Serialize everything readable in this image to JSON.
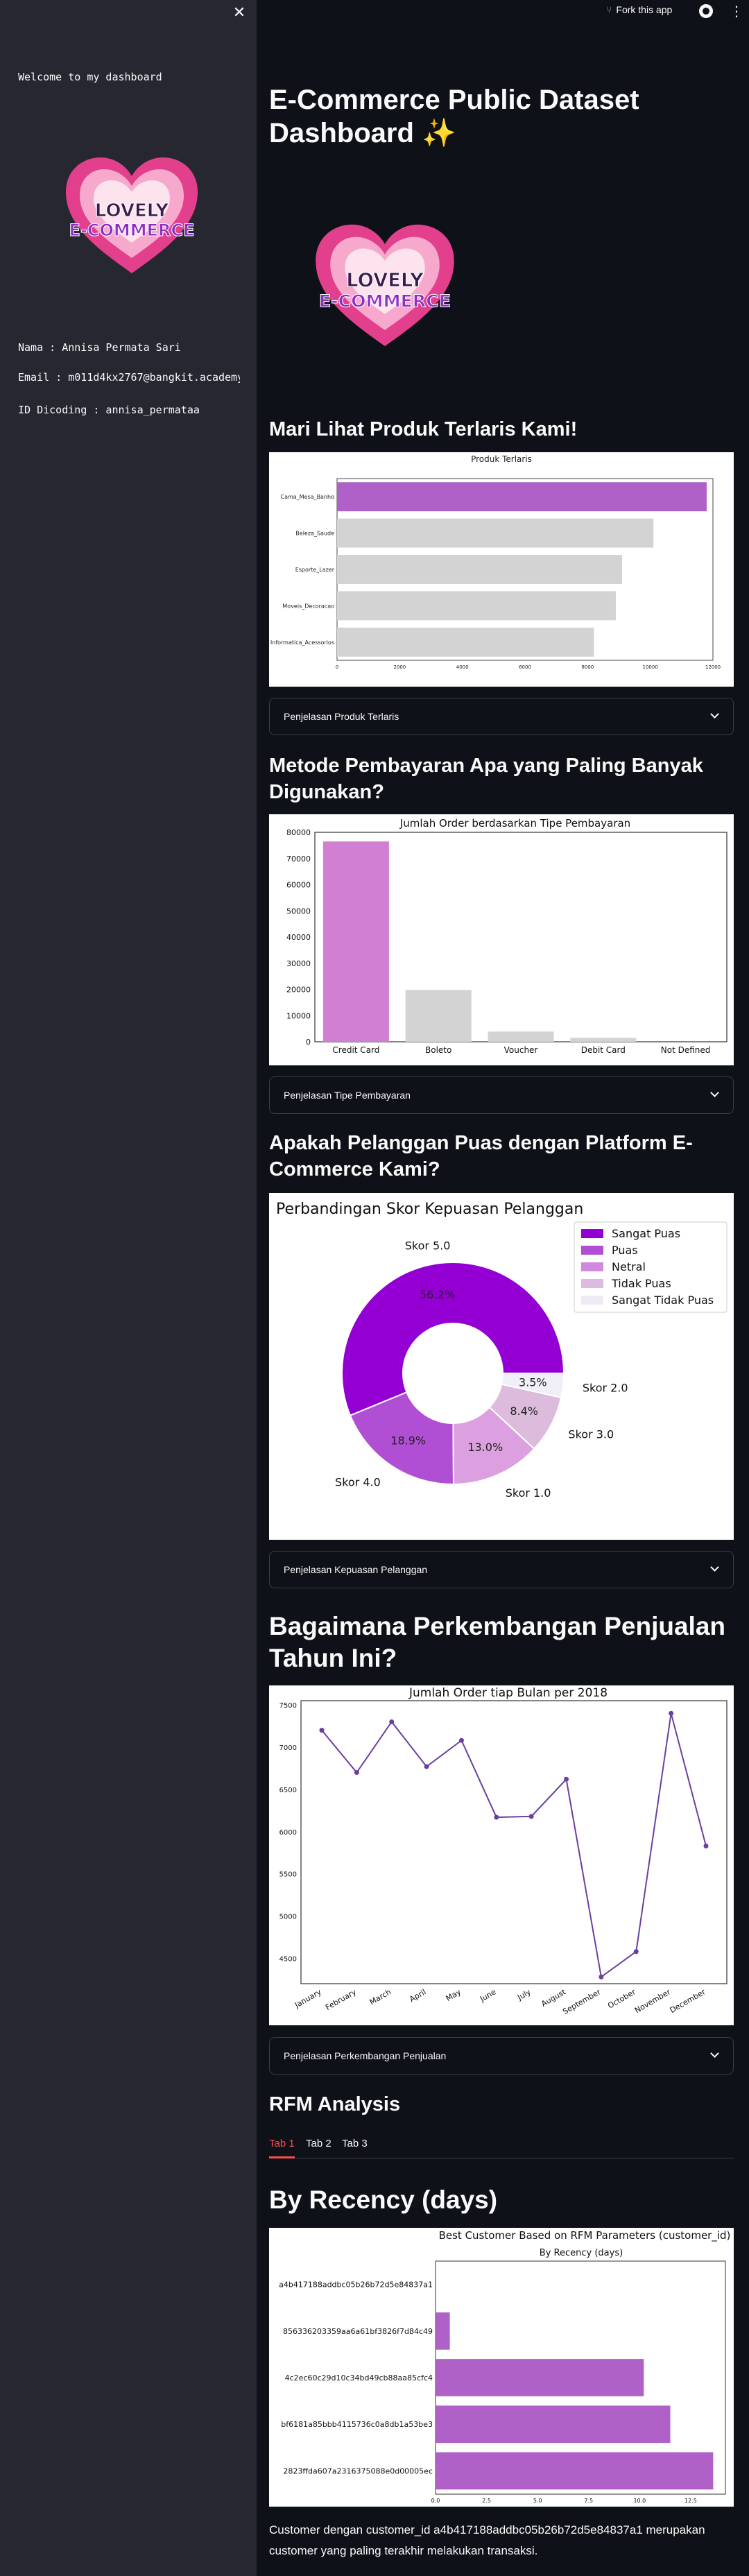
{
  "sidebar": {
    "welcome": "Welcome to my dashboard",
    "nama": "Nama : Annisa Permata Sari",
    "email": "Email : m011d4kx2767@bangkit.academy",
    "id": "ID Dicoding : annisa_permataa",
    "logo_line1": "LOVELY",
    "logo_line2": "E-COMMERCE"
  },
  "header": {
    "fork_label": "Fork this app"
  },
  "page": {
    "title": "E-Commerce Public Dataset Dashboard ✨",
    "logo_line1": "LOVELY",
    "logo_line2": "E-COMMERCE"
  },
  "sections": {
    "produk_heading": "Mari Lihat Produk Terlaris Kami!",
    "produk_expander": "Penjelasan Produk Terlaris",
    "pembayaran_heading": "Metode Pembayaran Apa yang Paling Banyak Digunakan?",
    "pembayaran_expander": "Penjelasan Tipe Pembayaran",
    "kepuasan_heading": "Apakah Pelanggan Puas dengan Platform E-Commerce Kami?",
    "kepuasan_expander": "Penjelasan Kepuasan Pelanggan",
    "penjualan_heading": "Bagaimana Perkembangan Penjualan Tahun Ini?",
    "penjualan_expander": "Penjelasan Perkembangan Penjualan",
    "rfm_heading": "RFM Analysis",
    "recency_heading": "By Recency (days)",
    "recency_text": "Customer dengan customer_id a4b417188addbc05b26b72d5e84837a1 merupakan customer yang paling terakhir melakukan transaksi."
  },
  "tabs": [
    "Tab 1",
    "Tab 2",
    "Tab 3"
  ],
  "colors": {
    "purple_main": "#b061c8",
    "grey_bar": "#d3d3d3",
    "accent_red": "#ff4b4b"
  },
  "chart_data": [
    {
      "type": "bar",
      "orientation": "horizontal",
      "title": "Produk Terlaris",
      "categories": [
        "Cama_Mesa_Banho",
        "Beleza_Saude",
        "Esporte_Lazer",
        "Moveis_Decoracao",
        "Informatica_Acessorios"
      ],
      "values": [
        11800,
        10100,
        9100,
        8900,
        8200
      ],
      "xticks": [
        "0",
        "2000",
        "4000",
        "6000",
        "8000",
        "10000",
        "12000"
      ],
      "xlim": [
        0,
        12000
      ]
    },
    {
      "type": "bar",
      "title": "Jumlah Order berdasarkan Tipe Pembayaran",
      "categories": [
        "Credit Card",
        "Boleto",
        "Voucher",
        "Debit Card",
        "Not Defined"
      ],
      "values": [
        76500,
        19800,
        3900,
        1500,
        3
      ],
      "yticks": [
        "0",
        "10000",
        "20000",
        "30000",
        "40000",
        "50000",
        "60000",
        "70000",
        "80000"
      ],
      "ylim": [
        0,
        80000
      ]
    },
    {
      "type": "pie",
      "title": "Perbandingan Skor Kepuasan Pelanggan",
      "labels": [
        "Skor 5.0",
        "Skor 4.0",
        "Skor 1.0",
        "Skor 3.0",
        "Skor 2.0"
      ],
      "values": [
        56.2,
        18.9,
        13.0,
        8.4,
        3.5
      ],
      "pct_labels": [
        "56.2%",
        "18.9%",
        "13.0%",
        "8.4%",
        "3.5%"
      ],
      "legend": [
        "Sangat Puas",
        "Puas",
        "Netral",
        "Tidak Puas",
        "Sangat Tidak Puas"
      ],
      "legend_colors": [
        "#9400d3",
        "#b14fd4",
        "#d089dc",
        "#ddbbe0",
        "#f0eaf5"
      ],
      "slice_colors": [
        "#9400d3",
        "#b14fd4",
        "#dca0e0",
        "#ddbbdd",
        "#f0eef6"
      ],
      "legend_position": "top-right"
    },
    {
      "type": "line",
      "title": "Jumlah Order tiap Bulan per 2018",
      "x": [
        "January",
        "February",
        "March",
        "April",
        "May",
        "June",
        "July",
        "August",
        "September",
        "October",
        "November",
        "December"
      ],
      "y": [
        7200,
        6700,
        7300,
        6770,
        7080,
        6170,
        6180,
        6620,
        4280,
        4580,
        7400,
        5830
      ],
      "yticks": [
        "4500",
        "5000",
        "5500",
        "6000",
        "6500",
        "7000",
        "7500"
      ],
      "ylim": [
        4200,
        7550
      ]
    },
    {
      "type": "bar",
      "orientation": "horizontal",
      "title": "Best Customer Based on RFM Parameters (customer_id)",
      "subtitle": "By Recency (days)",
      "categories": [
        "a4b417188addbc05b26b72d5e84837a1",
        "856336203359aa6a61bf3826f7d84c49",
        "4c2ec60c29d10c34bd49cb88aa85cfc4",
        "bf6181a85bbb4115736c0a8db1a53be3",
        "2823ffda607a2316375088e0d00005ec"
      ],
      "values": [
        0,
        0.7,
        10.2,
        11.5,
        13.6
      ],
      "xticks": [
        "0.0",
        "2.5",
        "5.0",
        "7.5",
        "10.0",
        "12.5"
      ],
      "xlim": [
        0,
        14.2
      ]
    }
  ]
}
